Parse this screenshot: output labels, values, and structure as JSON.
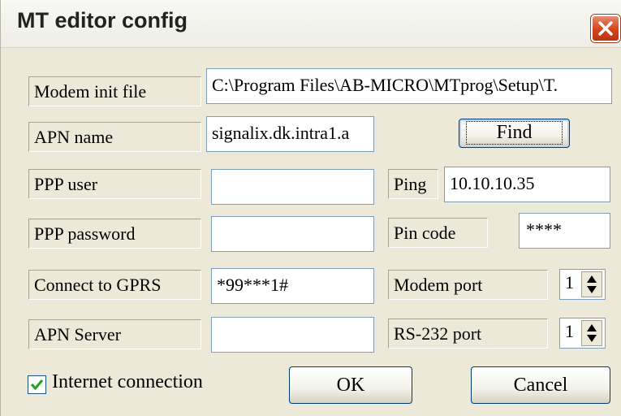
{
  "window": {
    "title": "MT editor config",
    "close_icon": "close-icon"
  },
  "labels": {
    "modem_init_file": "Modem init file",
    "apn_name": "APN name",
    "ppp_user": "PPP user",
    "ppp_password": "PPP password",
    "connect_to_gprs": "Connect to GPRS",
    "apn_server": "APN Server",
    "ping": "Ping",
    "pin_code": "Pin code",
    "modem_port": "Modem port",
    "rs232_port": "RS-232 port"
  },
  "values": {
    "modem_init_file": "C:\\Program Files\\AB-MICRO\\MTprog\\Setup\\T.",
    "apn_name": "signalix.dk.intra1.a",
    "ppp_user": "",
    "ppp_password": "",
    "connect_to_gprs": "*99***1#",
    "apn_server": "",
    "ping": "10.10.10.35",
    "pin_code": "****",
    "modem_port": "1",
    "rs232_port": "1"
  },
  "buttons": {
    "find": "Find",
    "ok": "OK",
    "cancel": "Cancel"
  },
  "checkbox": {
    "label": "Internet connection",
    "checked": true
  }
}
